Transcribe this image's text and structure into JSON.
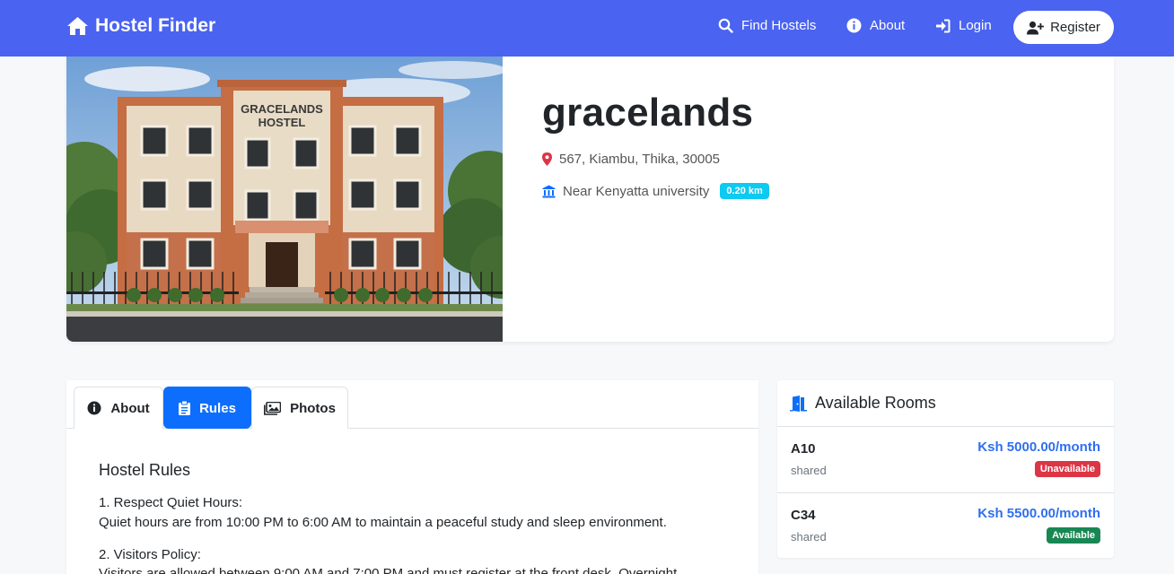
{
  "nav": {
    "brand": "Hostel Finder",
    "links": [
      {
        "label": "Find Hostels",
        "icon": "search-icon"
      },
      {
        "label": "About",
        "icon": "info-icon"
      },
      {
        "label": "Login",
        "icon": "login-icon"
      }
    ],
    "register": "Register"
  },
  "hostel": {
    "name": "gracelands",
    "address": "567, Kiambu, Thika, 30005",
    "near": "Near Kenyatta university",
    "distance": "0.20 km",
    "photo_sign": "GRACELANDS HOSTEL"
  },
  "tabs": [
    {
      "label": "About",
      "icon": "info-icon",
      "active": false
    },
    {
      "label": "Rules",
      "icon": "clipboard-icon",
      "active": true
    },
    {
      "label": "Photos",
      "icon": "images-icon",
      "active": false
    }
  ],
  "rules": {
    "title": "Hostel Rules",
    "items": [
      {
        "heading": "1. Respect Quiet Hours:",
        "text": "Quiet hours are from 10:00 PM to 6:00 AM to maintain a peaceful study and sleep environment."
      },
      {
        "heading": "2. Visitors Policy:",
        "text": "Visitors are allowed between 9:00 AM and 7:00 PM and must register at the front desk. Overnight"
      }
    ]
  },
  "rooms": {
    "title": "Available Rooms",
    "items": [
      {
        "name": "A10",
        "type": "shared",
        "price": "Ksh 5000.00/month",
        "status": "Unavailable",
        "status_color": "#dc3545"
      },
      {
        "name": "C34",
        "type": "shared",
        "price": "Ksh 5500.00/month",
        "status": "Available",
        "status_color": "#198754"
      }
    ]
  },
  "colors": {
    "navbar": "#4a63f0",
    "primary": "#0d6efd",
    "info": "#0dcaf0",
    "danger": "#dc3545",
    "success": "#198754"
  }
}
